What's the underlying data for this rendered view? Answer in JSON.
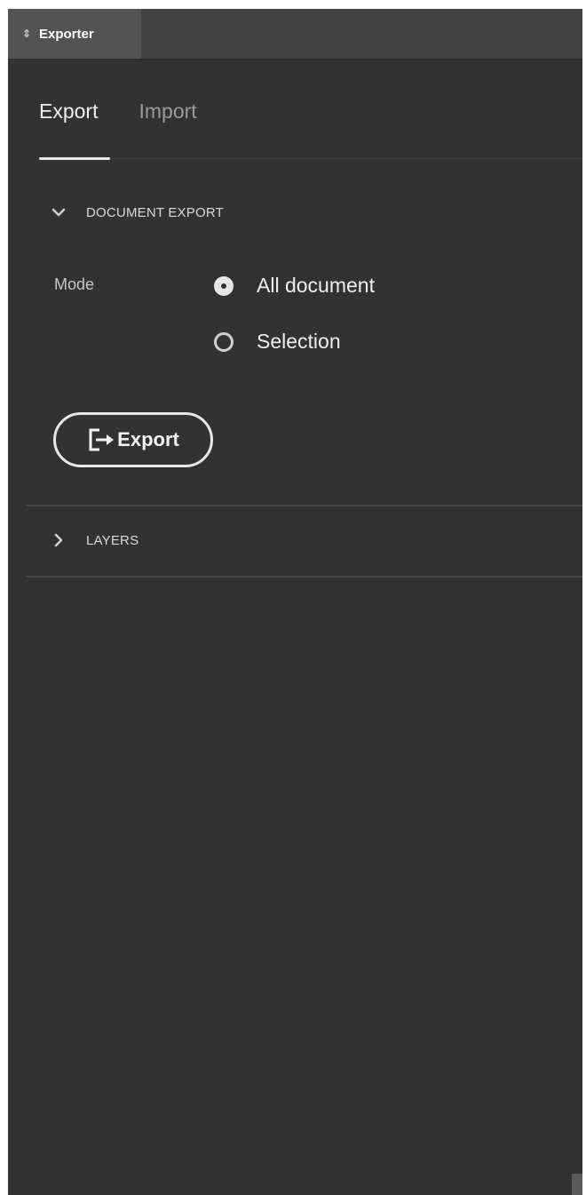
{
  "panel": {
    "title": "Exporter",
    "title_icon": "updown-arrows-icon"
  },
  "tabs": [
    {
      "label": "Export",
      "active": true
    },
    {
      "label": "Import",
      "active": false
    }
  ],
  "document_export": {
    "header": "DOCUMENT EXPORT",
    "expanded": true,
    "mode_label": "Mode",
    "options": [
      {
        "label": "All document",
        "selected": true
      },
      {
        "label": "Selection",
        "selected": false
      }
    ],
    "export_button": {
      "label": "Export",
      "icon": "export-arrow-icon"
    }
  },
  "layers": {
    "header": "LAYERS",
    "expanded": false
  },
  "colors": {
    "panel_bg": "#323232",
    "header_bg": "#424242",
    "tab_bg": "#535353",
    "text": "#efefef",
    "muted_text": "#9a9a9a"
  }
}
